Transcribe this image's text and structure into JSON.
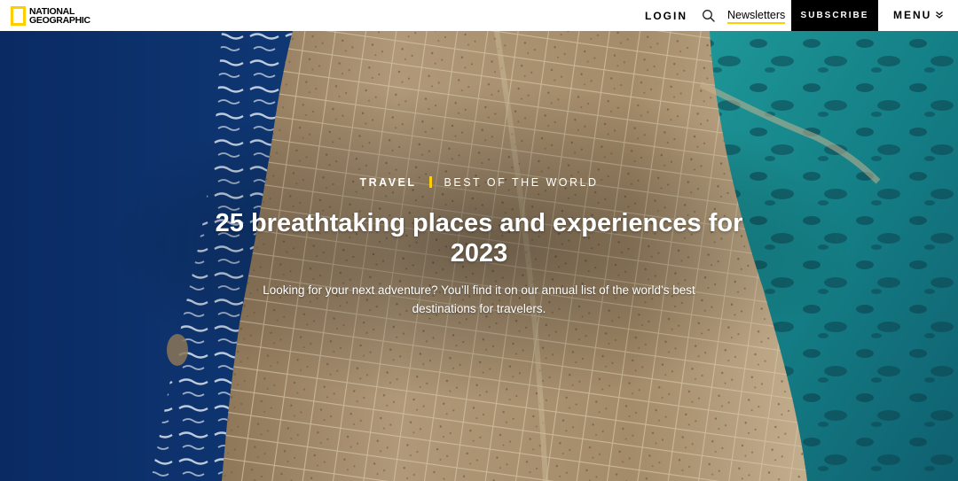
{
  "header": {
    "logo_line1": "NATIONAL",
    "logo_line2": "GEOGRAPHIC",
    "login_label": "LOGIN",
    "search_icon": "search-icon",
    "newsletters_label": "Newsletters",
    "subscribe_label": "SUBSCRIBE",
    "menu_label": "MENU",
    "menu_icon": "chevron-down-double-icon"
  },
  "hero": {
    "kicker_section": "TRAVEL",
    "kicker_series": "BEST OF THE WORLD",
    "title": "25 breathtaking places and experiences for 2023",
    "dek": "Looking for your next adventure? You’ll find it on our annual list of the world’s best destinations for travelers."
  },
  "colors": {
    "brand_yellow": "#FFCE00",
    "header_bg": "#FFFFFF",
    "subscribe_bg": "#000000",
    "deep_sea": "#0d2f6b",
    "lagoon": "#1a8a8a",
    "rock": "#a68e6c"
  }
}
